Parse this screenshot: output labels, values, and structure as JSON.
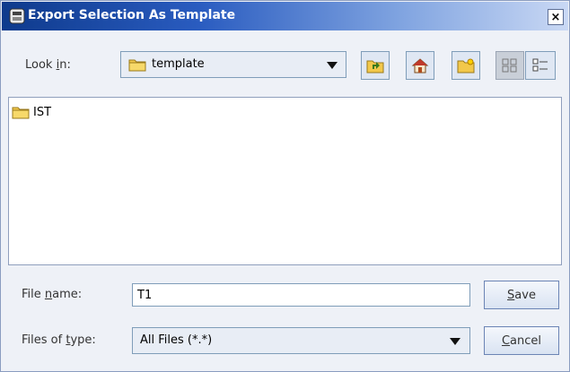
{
  "window": {
    "title": "Export Selection As Template",
    "close_glyph": "×"
  },
  "look_in": {
    "label_pre": "Look ",
    "label_mnemonic": "i",
    "label_post": "n:",
    "folder": "template",
    "icons": [
      "up-one-level-icon",
      "home-icon",
      "new-folder-icon",
      "list-view-icon",
      "details-view-icon"
    ]
  },
  "file_list": {
    "items": [
      {
        "name": "IST",
        "icon": "folder-icon"
      }
    ]
  },
  "file_name": {
    "label_pre": "File ",
    "label_mnemonic": "n",
    "label_post": "ame:",
    "value": "T1"
  },
  "file_type": {
    "label_pre": "Files of ",
    "label_mnemonic": "t",
    "label_post": "ype:",
    "value": "All Files (*.*)"
  },
  "buttons": {
    "save_mnemonic": "S",
    "save_rest": "ave",
    "cancel_mnemonic": "C",
    "cancel_rest": "ancel"
  },
  "colors": {
    "title_start": "#0e3a8c",
    "title_end": "#c9d8f4",
    "window_bg": "#eef1f7",
    "border": "#7f9db9",
    "folder": "#f2c84b"
  }
}
